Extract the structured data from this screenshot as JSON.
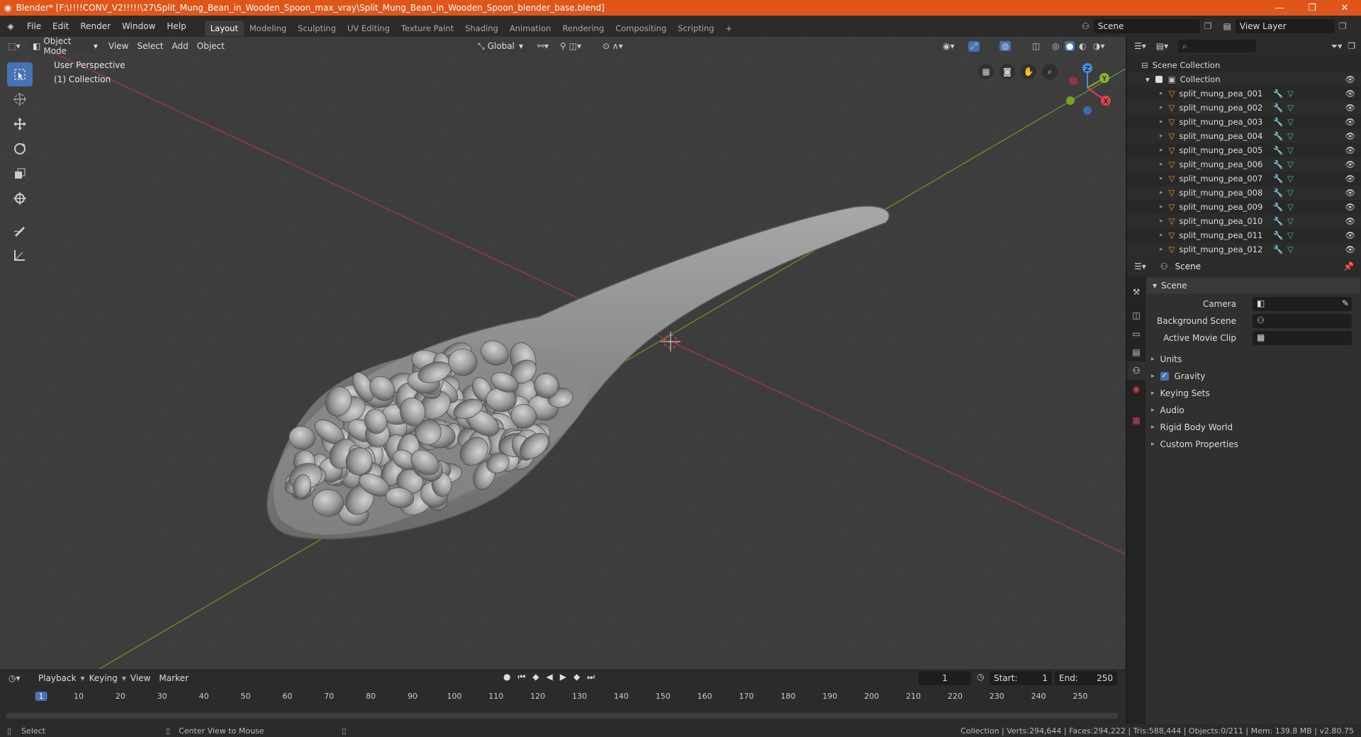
{
  "window": {
    "title": "Blender* [F:\\!!!!CONV_V2!!!!!\\27\\Split_Mung_Bean_in_Wooden_Spoon_max_vray\\Split_Mung_Bean_in_Wooden_Spoon_blender_base.blend]",
    "controls": [
      "—",
      "❐",
      "✕"
    ]
  },
  "menu": [
    "File",
    "Edit",
    "Render",
    "Window",
    "Help"
  ],
  "workspaces": [
    "Layout",
    "Modeling",
    "Sculpting",
    "UV Editing",
    "Texture Paint",
    "Shading",
    "Animation",
    "Rendering",
    "Compositing",
    "Scripting"
  ],
  "scene_field": "Scene",
  "viewlayer_field": "View Layer",
  "viewport": {
    "mode": "Object Mode",
    "menus": [
      "View",
      "Select",
      "Add",
      "Object"
    ],
    "orientation": "Global",
    "perspective_label": "User Perspective",
    "collection_label": "(1) Collection",
    "gizmo": {
      "x": "X",
      "y": "Y",
      "z": "Z"
    }
  },
  "outliner": {
    "scene_collection": "Scene Collection",
    "collection": "Collection",
    "items": [
      "split_mung_pea_001",
      "split_mung_pea_002",
      "split_mung_pea_003",
      "split_mung_pea_004",
      "split_mung_pea_005",
      "split_mung_pea_006",
      "split_mung_pea_007",
      "split_mung_pea_008",
      "split_mung_pea_009",
      "split_mung_pea_010",
      "split_mung_pea_011",
      "split_mung_pea_012"
    ]
  },
  "properties": {
    "header": "Scene",
    "panel": "Scene",
    "camera_label": "Camera",
    "background_label": "Background Scene",
    "movieclip_label": "Active Movie Clip",
    "sections": [
      "Units",
      "Gravity",
      "Keying Sets",
      "Audio",
      "Rigid Body World",
      "Custom Properties"
    ]
  },
  "timeline": {
    "menus": [
      "Playback",
      "Keying",
      "View",
      "Marker"
    ],
    "current_frame": "1",
    "start_label": "Start:",
    "start": "1",
    "end_label": "End:",
    "end": "250",
    "ticks": [
      "1",
      "10",
      "20",
      "30",
      "40",
      "50",
      "60",
      "70",
      "80",
      "90",
      "100",
      "110",
      "120",
      "130",
      "140",
      "150",
      "160",
      "170",
      "180",
      "190",
      "200",
      "210",
      "220",
      "230",
      "240",
      "250"
    ]
  },
  "status": {
    "left": "Select",
    "middle": "Center View to Mouse",
    "right": "Collection | Verts:294,644 | Faces:294,222 | Tris:588,444 | Objects:0/211 | Mem: 139.8 MB | v2.80.75"
  }
}
